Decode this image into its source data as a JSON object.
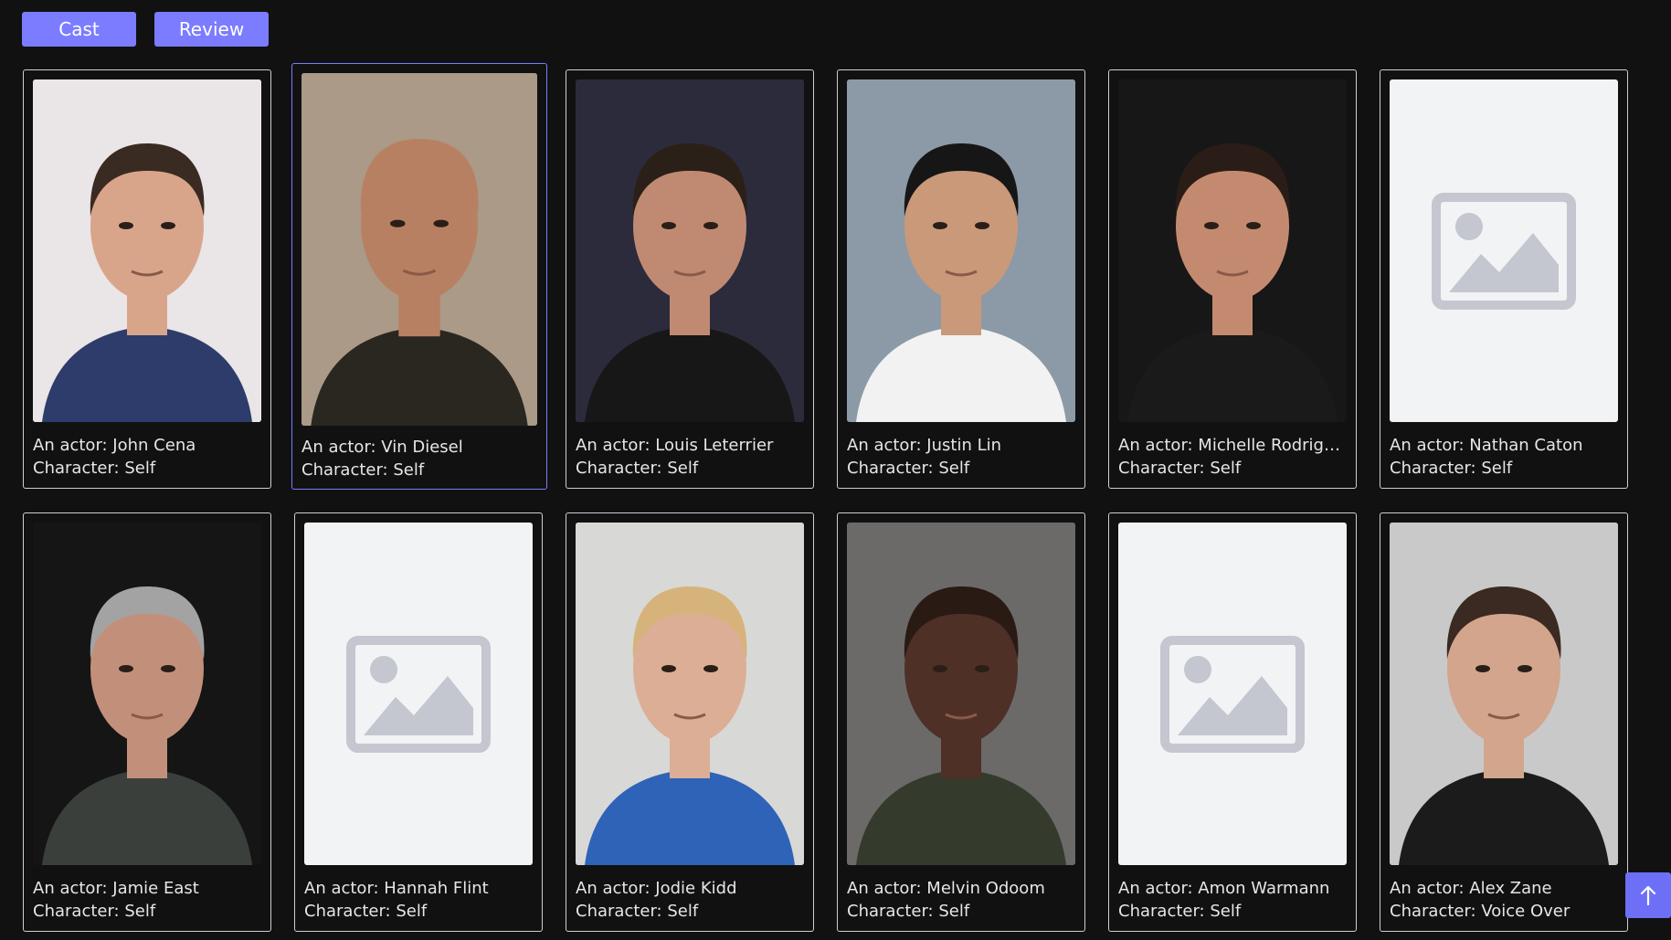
{
  "tabs": [
    {
      "label": "Cast"
    },
    {
      "label": "Review"
    }
  ],
  "cast": [
    {
      "actor": "An actor: John Cena",
      "character": "Character: Self",
      "photo": "portrait",
      "skin": "#d9a58a",
      "bg": "#eae5e6",
      "hair": "#3a2b22",
      "clothes": "#2d3c6b"
    },
    {
      "actor": "An actor: Vin Diesel",
      "character": "Character: Self",
      "photo": "portrait",
      "skin": "#b88062",
      "bg": "#aa9a87",
      "hair": "#b88062",
      "clothes": "#2a2620"
    },
    {
      "actor": "An actor: Louis Leterrier",
      "character": "Character: Self",
      "photo": "portrait",
      "skin": "#c08a72",
      "bg": "#2b2b3c",
      "hair": "#2a2018",
      "clothes": "#171717"
    },
    {
      "actor": "An actor: Justin Lin",
      "character": "Character: Self",
      "photo": "portrait",
      "skin": "#c9997a",
      "bg": "#8b9aa6",
      "hair": "#161616",
      "clothes": "#f2f2f2"
    },
    {
      "actor": "An actor: Michelle Rodrigu...",
      "character": "Character: Self",
      "photo": "portrait",
      "skin": "#c48a70",
      "bg": "#171717",
      "hair": "#2a1d17",
      "clothes": "#1a1a1a"
    },
    {
      "actor": "An actor: Nathan Caton",
      "character": "Character: Self",
      "photo": "placeholder"
    },
    {
      "actor": "An actor: Jamie East",
      "character": "Character: Self",
      "photo": "portrait",
      "skin": "#c2907a",
      "bg": "#151515",
      "hair": "#a3a3a3",
      "clothes": "#3b3f3b"
    },
    {
      "actor": "An actor: Hannah Flint",
      "character": "Character: Self",
      "photo": "placeholder"
    },
    {
      "actor": "An actor: Jodie Kidd",
      "character": "Character: Self",
      "photo": "portrait",
      "skin": "#dcae95",
      "bg": "#d8d8d6",
      "hair": "#d7b37c",
      "clothes": "#2e63b7"
    },
    {
      "actor": "An actor: Melvin Odoom",
      "character": "Character: Self",
      "photo": "portrait",
      "skin": "#4e3026",
      "bg": "#6b6a69",
      "hair": "#2a1a14",
      "clothes": "#343a2c"
    },
    {
      "actor": "An actor: Amon Warmann",
      "character": "Character: Self",
      "photo": "placeholder"
    },
    {
      "actor": "An actor: Alex Zane",
      "character": "Character: Voice Over",
      "photo": "portrait",
      "skin": "#d2a58c",
      "bg": "#c9c9c9",
      "hair": "#3a2a21",
      "clothes": "#1b1b1b"
    }
  ],
  "scroll_top": {
    "icon": "arrow-up-icon"
  }
}
